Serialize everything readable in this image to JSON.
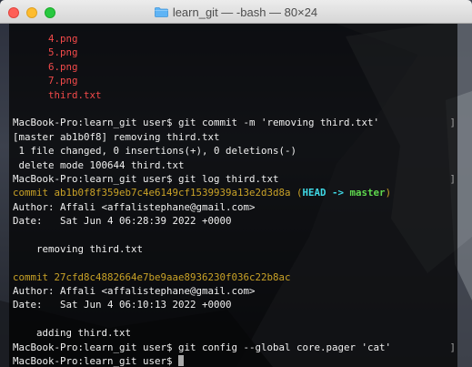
{
  "window": {
    "title": "learn_git — -bash — 80×24",
    "folder_icon": "folder-icon"
  },
  "colors": {
    "error_red": "#f34a4a",
    "commit_yellow": "#c9a227",
    "head_cyan": "#3fd9e6",
    "branch_green": "#5ed84e"
  },
  "terminal": {
    "files": [
      "4.png",
      "5.png",
      "6.png",
      "7.png",
      "third.txt"
    ],
    "prompt_commit": "MacBook-Pro:learn_git user$ git commit -m 'removing third.txt'",
    "commit_result": "[master ab1b0f8] removing third.txt",
    "commit_stats": " 1 file changed, 0 insertions(+), 0 deletions(-)",
    "commit_delete": " delete mode 100644 third.txt",
    "prompt_log": "MacBook-Pro:learn_git user$ git log third.txt",
    "commit1_hash": "commit ab1b0f8f359eb7c4e6149cf1539939a13e2d3d8a",
    "commit1_paren_open": " (",
    "commit1_head": "HEAD -> ",
    "commit1_branch": "master",
    "commit1_paren_close": ")",
    "commit1_author": "Author: Affali <affalistephane@gmail.com>",
    "commit1_date": "Date:   Sat Jun 4 06:28:39 2022 +0000",
    "commit1_message": "    removing third.txt",
    "commit2_hash": "commit 27cfd8c4882664e7be9aae8936230f036c22b8ac",
    "commit2_author": "Author: Affali <affalistephane@gmail.com>",
    "commit2_date": "Date:   Sat Jun 4 06:10:13 2022 +0000",
    "commit2_message": "    adding third.txt",
    "prompt_config": "MacBook-Pro:learn_git user$ git config --global core.pager 'cat'",
    "prompt_current": "MacBook-Pro:learn_git user$ "
  }
}
